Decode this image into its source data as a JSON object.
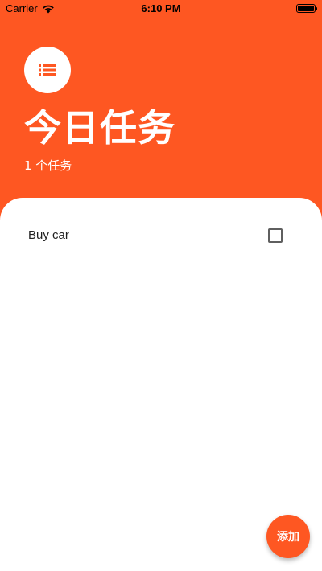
{
  "status_bar": {
    "carrier": "Carrier",
    "time": "6:10 PM",
    "wifi_icon": "wifi-icon",
    "battery_icon": "battery-icon"
  },
  "header": {
    "icon": "list-icon",
    "title": "今日任务",
    "task_count": "1 个任务"
  },
  "tasks": [
    {
      "label": "Buy car",
      "checked": false
    }
  ],
  "fab": {
    "label": "添加"
  },
  "colors": {
    "accent": "#fe5722",
    "surface": "#ffffff",
    "text": "#212121",
    "checkbox_border": "#5f5f5f"
  }
}
